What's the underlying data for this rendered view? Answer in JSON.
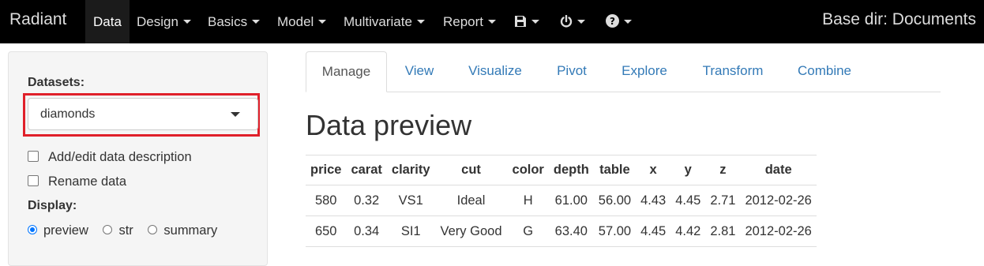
{
  "navbar": {
    "brand": "Radiant",
    "items": [
      {
        "label": "Data",
        "caret": false
      },
      {
        "label": "Design",
        "caret": true
      },
      {
        "label": "Basics",
        "caret": true
      },
      {
        "label": "Model",
        "caret": true
      },
      {
        "label": "Multivariate",
        "caret": true
      },
      {
        "label": "Report",
        "caret": true
      }
    ],
    "icons": [
      "save-icon",
      "power-icon",
      "help-icon"
    ],
    "base_dir": "Base dir: Documents"
  },
  "sidebar": {
    "datasets_label": "Datasets:",
    "dataset_selected": "diamonds",
    "checkbox_description": "Add/edit data description",
    "checkbox_rename": "Rename data",
    "display_label": "Display:",
    "display_options": [
      "preview",
      "str",
      "summary"
    ],
    "display_selected": "preview"
  },
  "tabs": [
    "Manage",
    "View",
    "Visualize",
    "Pivot",
    "Explore",
    "Transform",
    "Combine"
  ],
  "active_tab": "Manage",
  "main": {
    "title": "Data preview",
    "table": {
      "columns": [
        "price",
        "carat",
        "clarity",
        "cut",
        "color",
        "depth",
        "table",
        "x",
        "y",
        "z",
        "date"
      ],
      "rows": [
        [
          "580",
          "0.32",
          "VS1",
          "Ideal",
          "H",
          "61.00",
          "56.00",
          "4.43",
          "4.45",
          "2.71",
          "2012-02-26"
        ],
        [
          "650",
          "0.34",
          "SI1",
          "Very Good",
          "G",
          "63.40",
          "57.00",
          "4.45",
          "4.42",
          "2.81",
          "2012-02-26"
        ]
      ]
    }
  },
  "colors": {
    "navbar_bg": "#000000",
    "link": "#337ab7",
    "highlight": "#e0202a",
    "radio_accent": "#0075ff"
  }
}
